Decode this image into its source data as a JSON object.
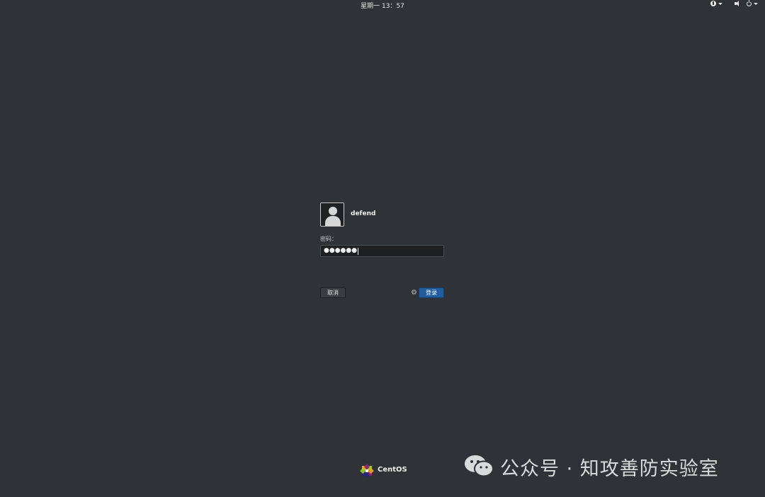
{
  "top_bar": {
    "clock": "星期一 13：57",
    "icons": [
      "accessibility-icon",
      "volume-icon",
      "power-icon"
    ]
  },
  "login": {
    "username": "defend",
    "password_label": "密码：",
    "password_mask": "●●●●●●",
    "cancel_label": "取消",
    "login_label": "登录"
  },
  "footer": {
    "brand": "CentOS"
  },
  "watermark": {
    "text": "公众号 · 知攻善防实验室"
  },
  "colors": {
    "background": "#2f3236",
    "login_button": "#215d9c"
  }
}
